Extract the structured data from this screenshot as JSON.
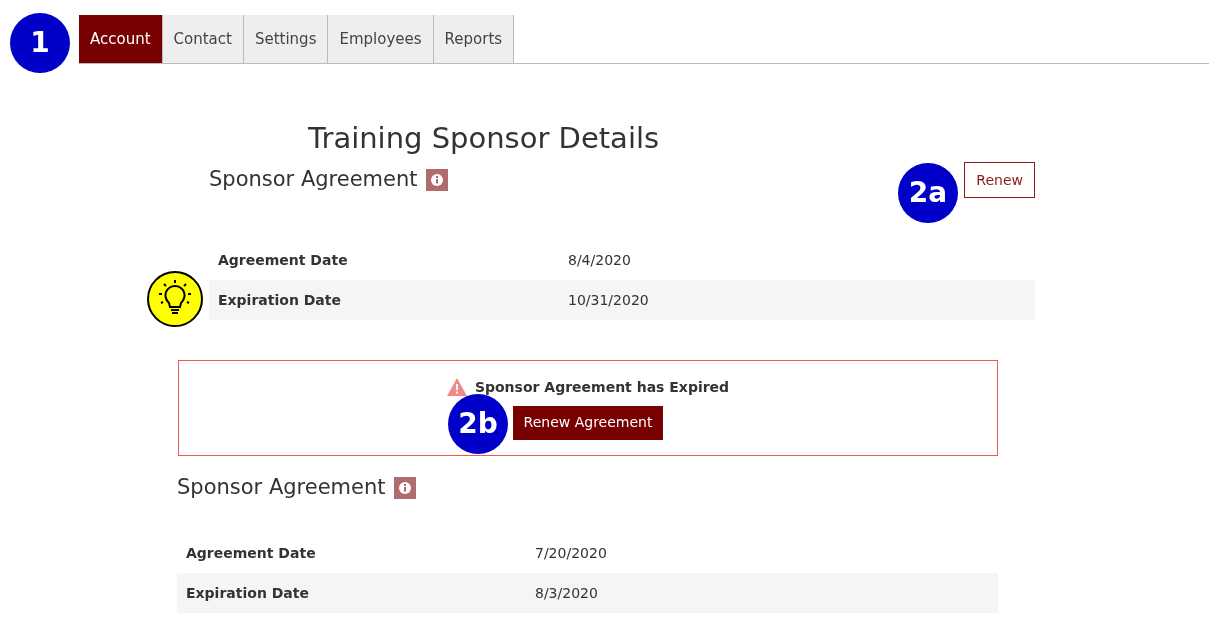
{
  "tabs": [
    {
      "label": "Account",
      "selected": true
    },
    {
      "label": "Contact",
      "selected": false
    },
    {
      "label": "Settings",
      "selected": false
    },
    {
      "label": "Employees",
      "selected": false
    },
    {
      "label": "Reports",
      "selected": false
    }
  ],
  "title": "Training Sponsor Details",
  "current_agreement": {
    "heading": "Sponsor Agreement",
    "action": "Renew",
    "rows": [
      {
        "label": "Agreement Date",
        "value": "8/4/2020"
      },
      {
        "label": "Expiration Date",
        "value": "10/31/2020"
      }
    ]
  },
  "alert": {
    "message": "Sponsor Agreement has Expired",
    "action": "Renew Agreement"
  },
  "previous_agreement": {
    "heading": "Sponsor Agreement",
    "rows": [
      {
        "label": "Agreement Date",
        "value": "7/20/2020"
      },
      {
        "label": "Expiration Date",
        "value": "8/3/2020"
      }
    ]
  },
  "callouts": [
    {
      "kind": "number",
      "label": "1"
    },
    {
      "kind": "number",
      "label": "2a"
    },
    {
      "kind": "tip"
    },
    {
      "kind": "number",
      "label": "2b"
    }
  ]
}
